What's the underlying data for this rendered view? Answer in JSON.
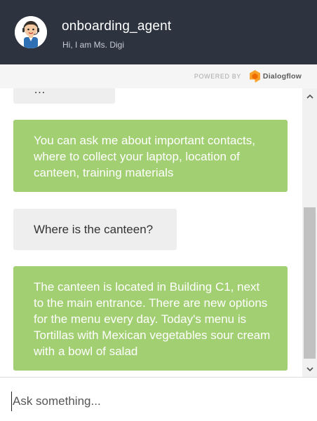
{
  "header": {
    "agent_name": "onboarding_agent",
    "subtitle": "Hi, I am Ms. Digi"
  },
  "powered_bar": {
    "label": "POWERED BY",
    "brand": "Dialogflow",
    "brand_color": "#f8a12a"
  },
  "messages": [
    {
      "sender": "user",
      "text": "…"
    },
    {
      "sender": "bot",
      "text": "You can ask me about important contacts, where to collect your laptop, location of canteen, training materials"
    },
    {
      "sender": "user",
      "text": "Where is the canteen?"
    },
    {
      "sender": "bot",
      "text": "The canteen is located in Building C1, next to the main entrance. There are new options for the menu every day. Today's menu is Tortillas with Mexican vegetables sour cream with a bowl of salad"
    }
  ],
  "input": {
    "placeholder": "Ask something..."
  },
  "colors": {
    "header_bg": "#2d3440",
    "bot_bubble": "#a2cf72",
    "user_bubble": "#eeeeee"
  }
}
